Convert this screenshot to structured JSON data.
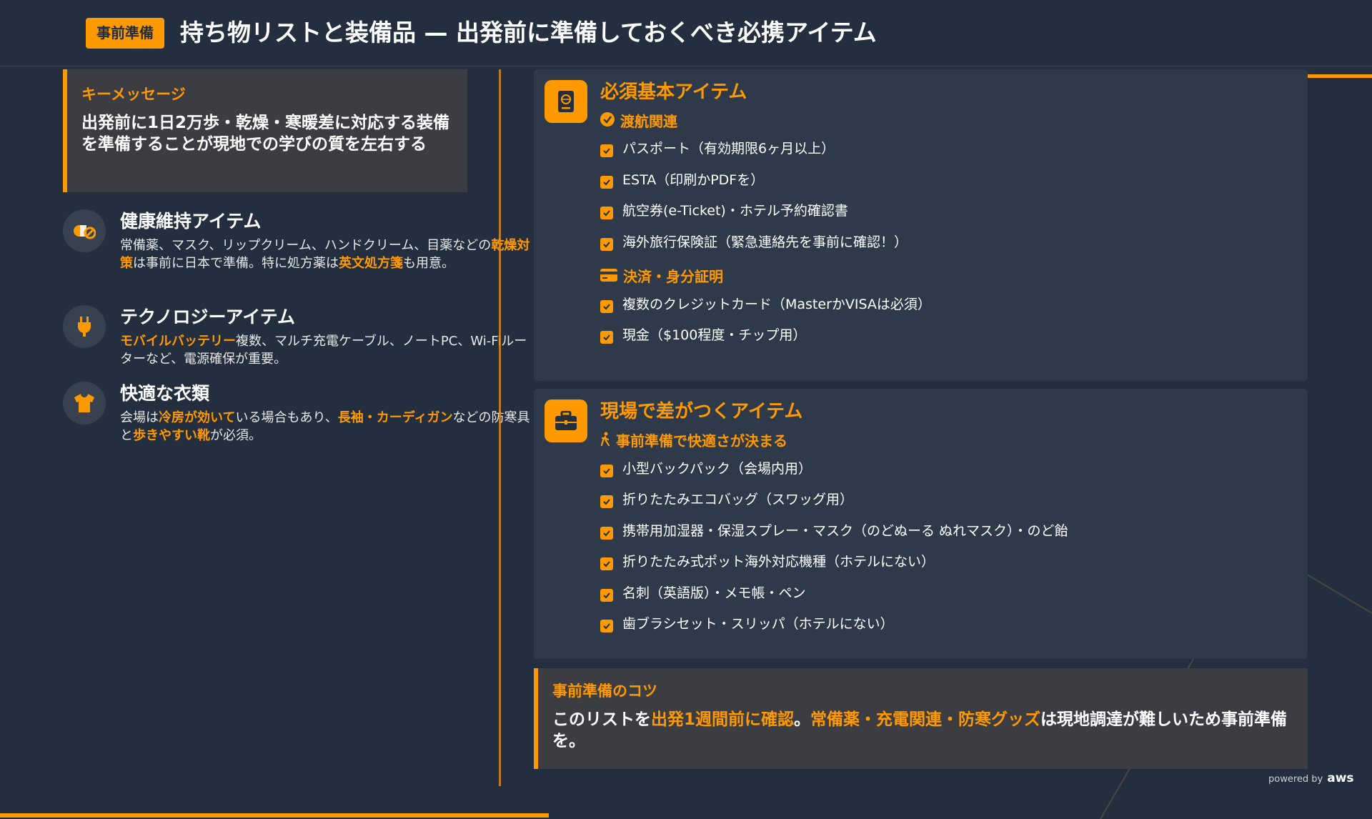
{
  "header": {
    "badge": "事前準備",
    "title": "持ち物リストと装備品 — 出発前に準備しておくべき必携アイテム"
  },
  "key_message": {
    "heading": "キーメッセージ",
    "text": "出発前に1日2万歩・乾燥・寒暖差に対応する装備を準備することが現地での学びの質を左右する"
  },
  "features": [
    {
      "title": "健康維持アイテム",
      "icon": "pills-icon",
      "desc_parts": [
        "常備薬、マスク、リップクリーム、ハンドクリーム、目薬などの",
        "乾燥対策",
        "は事前に日本で準備。特に処方薬は",
        "英文処方箋",
        "も用意。"
      ]
    },
    {
      "title": "テクノロジーアイテム",
      "icon": "plug-icon",
      "desc_parts": [
        "",
        "モバイルバッテリー",
        "複数、マルチ充電ケーブル、ノートPC、Wi-Fiルーターなど、電源確保が重要。"
      ]
    },
    {
      "title": "快適な衣類",
      "icon": "tshirt-icon",
      "desc_parts": [
        "会場は",
        "冷房が効いて",
        "いる場合もあり、",
        "長袖・カーディガン",
        "などの防寒具と",
        "歩きやすい靴",
        "が必須。"
      ]
    }
  ],
  "card_essentials": {
    "icon": "passport-icon",
    "title": "必須基本アイテム",
    "groups": [
      {
        "label": "渡航関連",
        "icon": "check-circle-icon",
        "items": [
          "パスポート（有効期限6ヶ月以上）",
          "ESTA（印刷かPDFを）",
          "航空券(e-Ticket)・ホテル予約確認書",
          "海外旅行保険証（緊急連絡先を事前に確認！）"
        ]
      },
      {
        "label": "決済・身分証明",
        "icon": "credit-card-icon",
        "items": [
          "複数のクレジットカード（MasterかVISAは必須）",
          "現金（$100程度・チップ用）"
        ]
      }
    ]
  },
  "card_onsite": {
    "icon": "briefcase-icon",
    "title": "現場で差がつくアイテム",
    "subhead": "事前準備で快適さが決まる",
    "subhead_icon": "walking-icon",
    "items": [
      "小型バックパック（会場内用）",
      "折りたたみエコバッグ（スワッグ用）",
      "携帯用加湿器・保湿スプレー・マスク（のどぬーる ぬれマスク）・のど飴",
      "折りたたみ式ポット海外対応機種（ホテルにない）",
      "名刺（英語版）・メモ帳・ペン",
      "歯ブラシセット・スリッパ（ホテルにない）"
    ]
  },
  "tips": {
    "heading": "事前準備のコツ",
    "parts": [
      "このリストを",
      "出発1週間前に確認",
      "。",
      "常備薬・充電関連・防寒グッズ",
      "は現地調達が難しいため事前準備を。"
    ]
  },
  "footer": {
    "powered_by": "powered by",
    "brand": "aws"
  },
  "colors": {
    "background": "#232f3e",
    "accent": "#ff9900",
    "card": "#2e3a4a",
    "callout": "#3b3d42"
  }
}
